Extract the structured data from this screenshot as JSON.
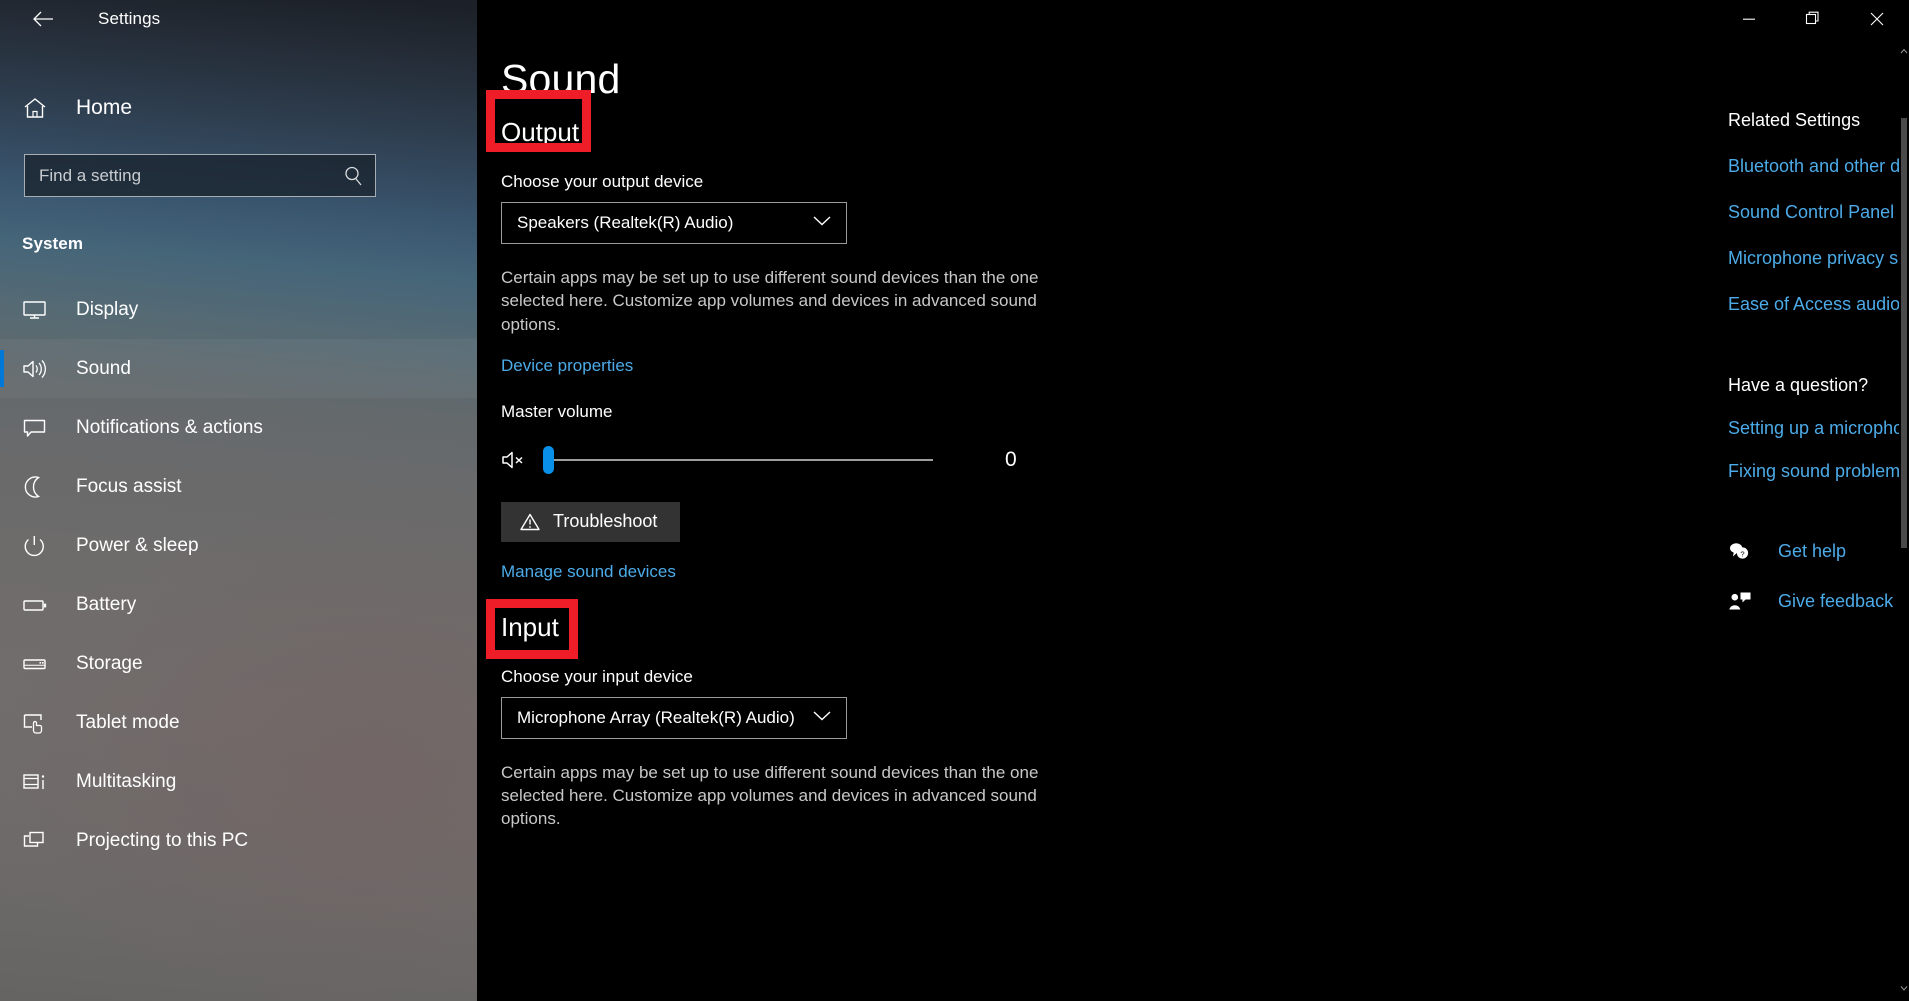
{
  "window": {
    "title": "Settings",
    "back_label": "Back",
    "controls": {
      "minimize": "Minimize",
      "maximize": "Restore",
      "close": "Close"
    }
  },
  "sidebar": {
    "home_label": "Home",
    "search": {
      "placeholder": "Find a setting",
      "value": ""
    },
    "group_label": "System",
    "items": [
      {
        "label": "Display",
        "icon": "monitor-icon",
        "active": false
      },
      {
        "label": "Sound",
        "icon": "speaker-icon",
        "active": true
      },
      {
        "label": "Notifications & actions",
        "icon": "chat-icon",
        "active": false
      },
      {
        "label": "Focus assist",
        "icon": "moon-icon",
        "active": false
      },
      {
        "label": "Power & sleep",
        "icon": "power-icon",
        "active": false
      },
      {
        "label": "Battery",
        "icon": "battery-icon",
        "active": false
      },
      {
        "label": "Storage",
        "icon": "drive-icon",
        "active": false
      },
      {
        "label": "Tablet mode",
        "icon": "tablet-icon",
        "active": false
      },
      {
        "label": "Multitasking",
        "icon": "multitask-icon",
        "active": false
      },
      {
        "label": "Projecting to this PC",
        "icon": "project-icon",
        "active": false
      }
    ]
  },
  "page": {
    "title": "Sound",
    "output": {
      "heading": "Output",
      "device_label": "Choose your output device",
      "device_value": "Speakers (Realtek(R) Audio)",
      "description": "Certain apps may be set up to use different sound devices than the one selected here. Customize app volumes and devices in advanced sound options.",
      "device_properties_link": "Device properties",
      "volume_label": "Master volume",
      "volume_value": "0",
      "volume_percent": 0,
      "mute_icon": "speaker-muted-icon",
      "troubleshoot_label": "Troubleshoot",
      "troubleshoot_icon": "warning-triangle-icon",
      "manage_link": "Manage sound devices"
    },
    "input": {
      "heading": "Input",
      "device_label": "Choose your input device",
      "device_value": "Microphone Array (Realtek(R) Audio)",
      "description": "Certain apps may be set up to use different sound devices than the one selected here. Customize app volumes and devices in advanced sound options."
    }
  },
  "rail": {
    "related_heading": "Related Settings",
    "related_links": [
      "Bluetooth and other devices",
      "Sound Control Panel",
      "Microphone privacy settings",
      "Ease of Access audio settings"
    ],
    "question_heading": "Have a question?",
    "question_links": [
      "Setting up a microphone",
      "Fixing sound problems"
    ],
    "help_items": [
      {
        "label": "Get help",
        "icon": "help-bubble-icon"
      },
      {
        "label": "Give feedback",
        "icon": "feedback-icon"
      }
    ]
  },
  "annotations": {
    "color": "#ef1d28",
    "boxes": [
      "output-heading",
      "input-heading"
    ]
  }
}
